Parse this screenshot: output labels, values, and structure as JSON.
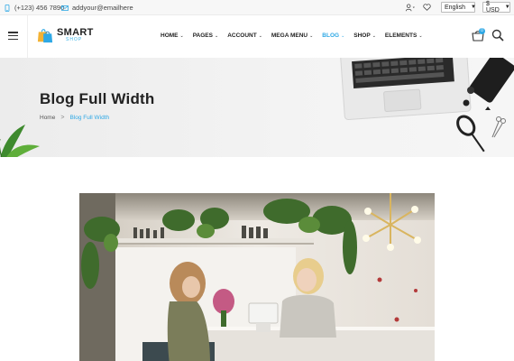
{
  "topbar": {
    "phone": "(+123) 456 7890",
    "email": "addyour@emailhere",
    "language": "English",
    "currency": "$ USD"
  },
  "header": {
    "logo_name": "SMART",
    "logo_sub": "SHOP",
    "nav": [
      {
        "label": "HOME",
        "active": false
      },
      {
        "label": "PAGES",
        "active": false
      },
      {
        "label": "ACCOUNT",
        "active": false
      },
      {
        "label": "MEGA MENU",
        "active": false
      },
      {
        "label": "BLOG",
        "active": true
      },
      {
        "label": "SHOP",
        "active": false
      },
      {
        "label": "ELEMENTS",
        "active": false
      }
    ],
    "cart_count": "0"
  },
  "banner": {
    "title": "Blog Full Width",
    "breadcrumb_home": "Home",
    "breadcrumb_separator": ">",
    "breadcrumb_current": "Blog Full Width"
  },
  "colors": {
    "accent": "#2ea8e5",
    "text": "#222222",
    "banner_bg": "#efefef"
  }
}
